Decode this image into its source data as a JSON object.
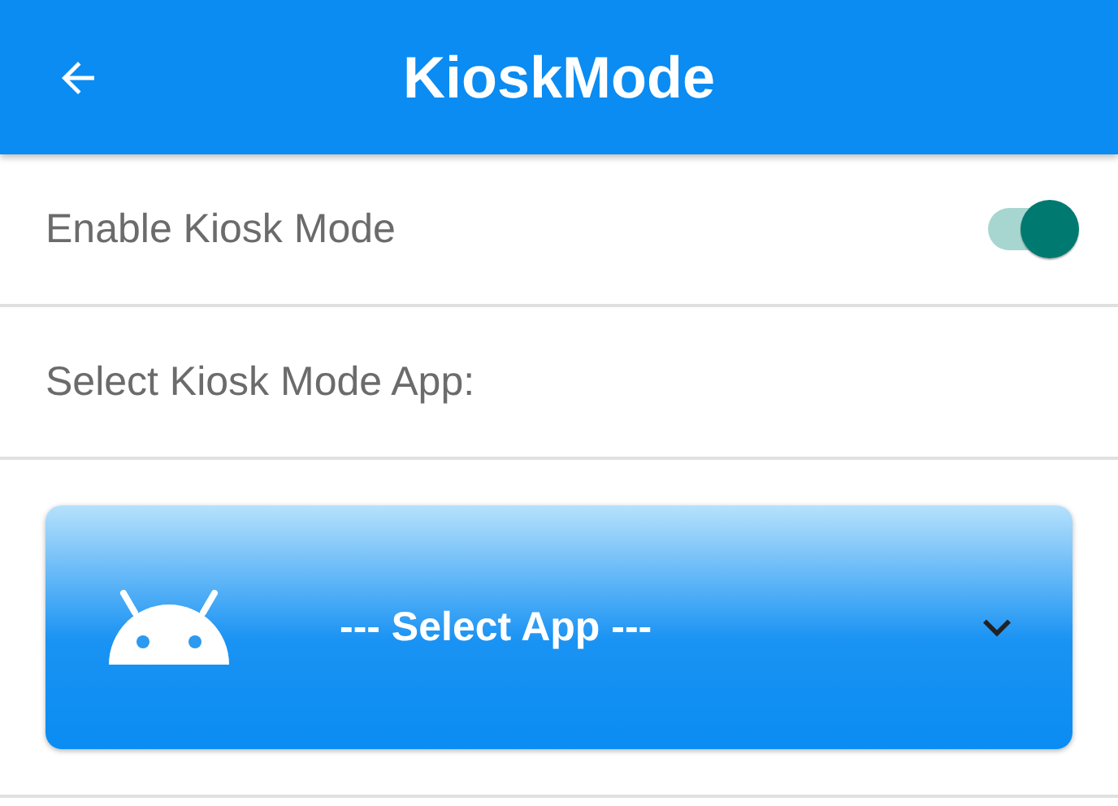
{
  "app_bar": {
    "title": "KioskMode"
  },
  "settings": [
    {
      "kind": "switch",
      "label": "Enable Kiosk Mode",
      "on": true
    },
    {
      "kind": "label",
      "label": "Select Kiosk Mode App:"
    }
  ],
  "app_picker": {
    "value": "--- Select App ---"
  }
}
